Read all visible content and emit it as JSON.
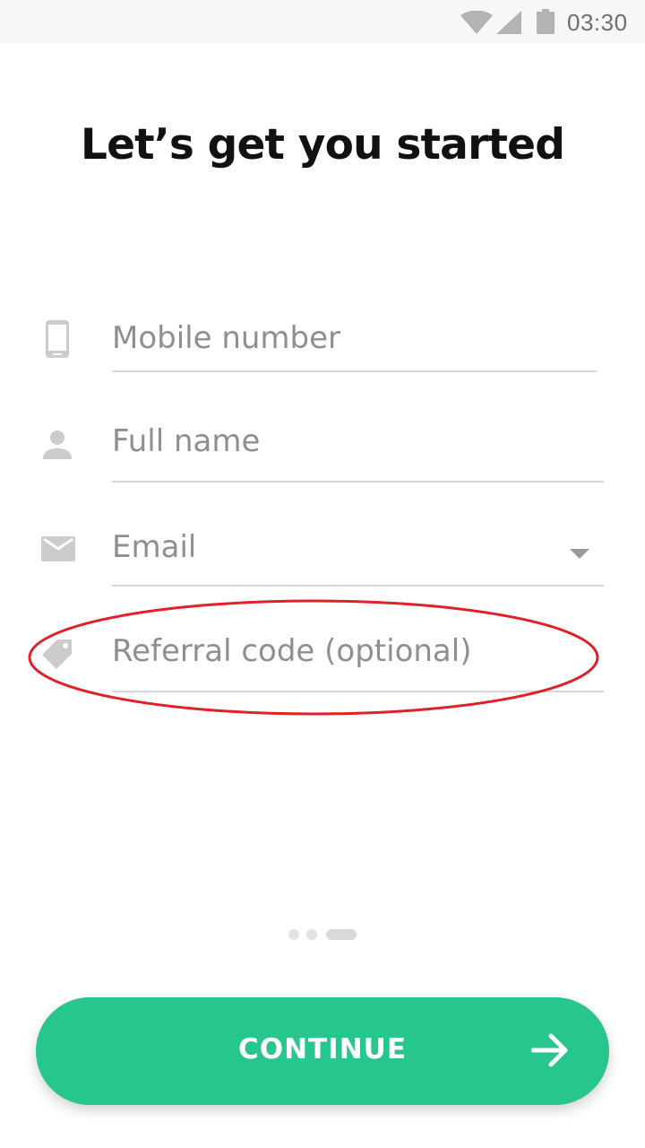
{
  "status_bar": {
    "time": "03:30",
    "icons": [
      "wifi-icon",
      "signal-icon",
      "battery-icon"
    ]
  },
  "page": {
    "title": "Let’s get you started"
  },
  "form": {
    "mobile": {
      "placeholder": "Mobile number",
      "icon": "phone-icon"
    },
    "full_name": {
      "placeholder": "Full name",
      "icon": "person-icon"
    },
    "email": {
      "placeholder": "Email",
      "icon": "mail-icon",
      "has_dropdown": true
    },
    "referral": {
      "placeholder": "Referral code (optional)",
      "icon": "tag-icon"
    }
  },
  "pager": {
    "count": 3,
    "active_index": 2
  },
  "continue_button": {
    "label": "CONTINUE",
    "icon": "arrow-right-icon"
  },
  "colors": {
    "accent": "#27c68c",
    "placeholder": "#8f8f8f",
    "icon": "#cccccc",
    "annotation": "#e0202a"
  }
}
